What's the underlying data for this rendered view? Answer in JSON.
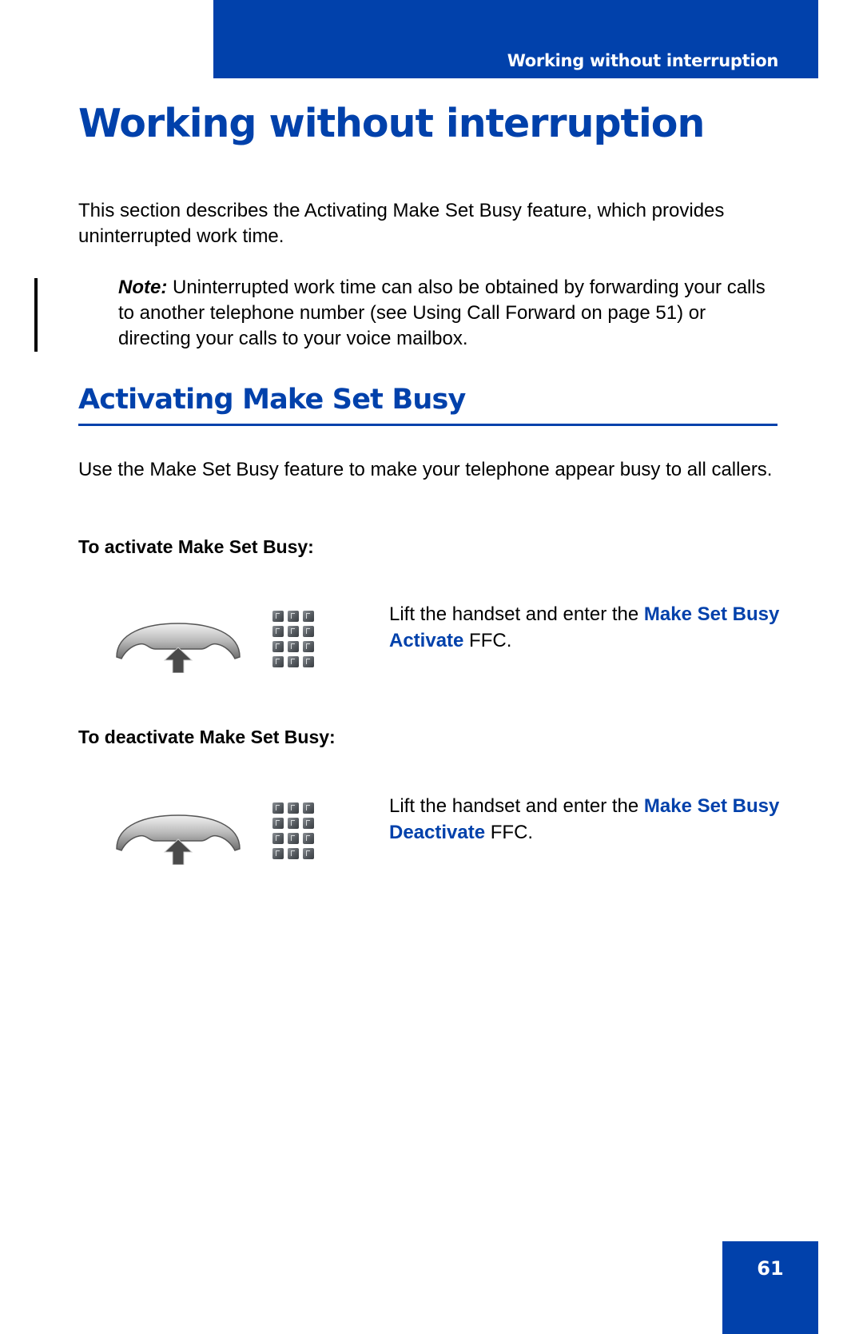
{
  "header": {
    "running_title": "Working without interruption",
    "accent_color": "#0141ab"
  },
  "page_title": "Working without interruption",
  "intro": "This section describes the Activating Make Set Busy feature, which provides uninterrupted work time.",
  "note": {
    "label": "Note:",
    "text": " Uninterrupted work time can also be obtained by forwarding your calls to another telephone number (see Using Call Forward on page 51) or directing your calls to your voice mailbox."
  },
  "section": {
    "title": "Activating Make Set Busy",
    "description": "Use the Make Set Busy feature to make your telephone appear busy to all callers."
  },
  "procedures": [
    {
      "heading": "To activate Make Set Busy:",
      "icons": [
        "handset-lift-icon",
        "keypad-icon"
      ],
      "text_before": "Lift the handset and enter the ",
      "feature_code_name": "Make Set Busy Activate",
      "text_after": " FFC."
    },
    {
      "heading": "To deactivate Make Set Busy:",
      "icons": [
        "handset-lift-icon",
        "keypad-icon"
      ],
      "text_before": "Lift the handset and enter the ",
      "feature_code_name": "Make Set Busy Deactivate",
      "text_after": " FFC."
    }
  ],
  "footer": {
    "page_number": "61"
  }
}
